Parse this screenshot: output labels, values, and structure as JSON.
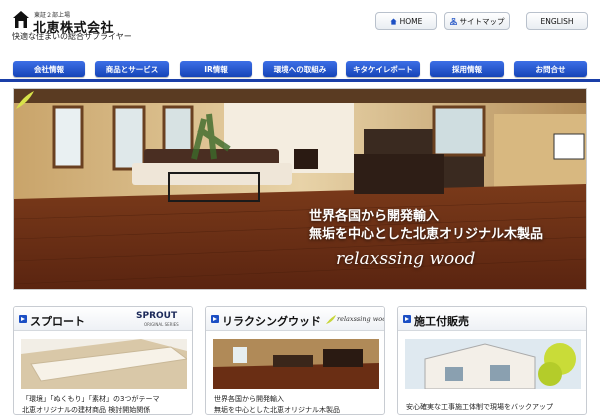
{
  "header": {
    "logo_subtext": "東証２部上場",
    "company_name": "北恵株式会社",
    "tagline": "快適な住まいの総合サプライヤー",
    "buttons": [
      {
        "label": "HOME",
        "icon": "home-icon"
      },
      {
        "label": "サイトマップ",
        "icon": "sitemap-icon"
      },
      {
        "label": "ENGLISH",
        "icon": ""
      }
    ]
  },
  "nav": {
    "items": [
      "会社情報",
      "商品とサービス",
      "IR情報",
      "環境への取組み",
      "キタケイレポート",
      "採用情報",
      "お問合せ"
    ]
  },
  "hero": {
    "line1": "世界各国から開発輸入",
    "line2": "無垢を中心とした北恵オリジナル木製品",
    "brand": "relaxssing wood"
  },
  "panels": [
    {
      "title": "スプロート",
      "logo_text": "SPROUT",
      "logo_sub": "ORIGINAL SERIES",
      "text1": "「環境」「ぬくもり」「素材」の3つがテーマ",
      "text2": "北恵オリジナルの建材商品 検討開始関係"
    },
    {
      "title": "リラクシングウッド",
      "logo_text": "relaxssing wood",
      "text1": "世界各国から開発輸入",
      "text2": "無垢を中心とした北恵オリジナル木製品"
    },
    {
      "title": "施工付販売",
      "text1": "安心確実な工事施工体制で現場をバックアップ",
      "text2": ""
    }
  ],
  "colors": {
    "nav_blue": "#1c4fc4",
    "nav_line": "#1a3fa8"
  }
}
